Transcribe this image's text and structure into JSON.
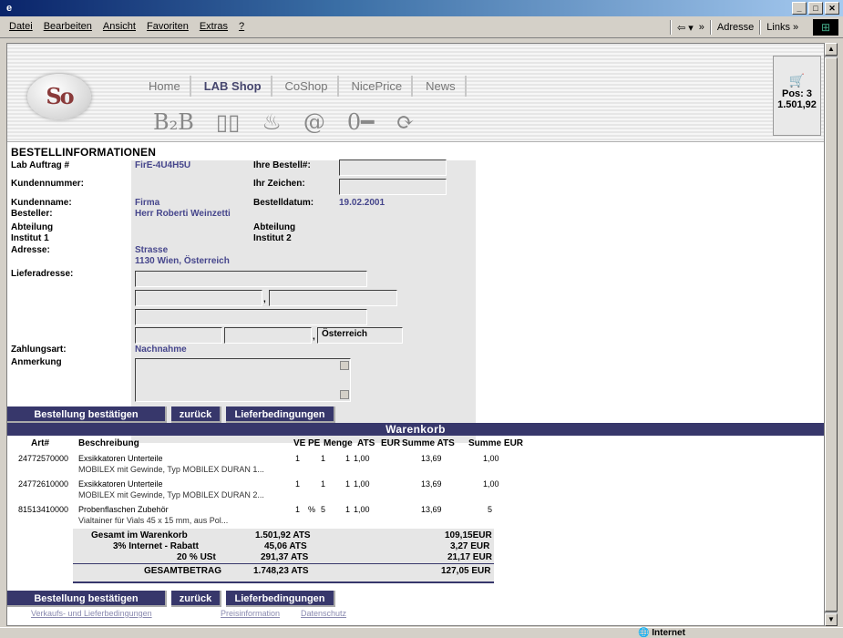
{
  "menu": [
    "Datei",
    "Bearbeiten",
    "Ansicht",
    "Favoriten",
    "Extras",
    "?"
  ],
  "toolbar": {
    "back": "⇦ ▾",
    "more": "»",
    "address": "Adresse",
    "links": "Links »"
  },
  "status": {
    "zone": "Internet"
  },
  "site": {
    "logo": "So",
    "tabs": [
      "Home",
      "LAB Shop",
      "CoShop",
      "NicePrice",
      "News"
    ],
    "active_tab": "LAB Shop",
    "icons": [
      "B2B",
      "book-icon",
      "stamp-icon",
      "at-icon",
      "key-icon",
      "refresh-icon"
    ],
    "icon_labels": [
      "B₂B",
      "▯▯",
      "♨",
      "@",
      "0━",
      "⟳"
    ],
    "cart": {
      "pos": "Pos: 3",
      "amount": "1.501,92"
    }
  },
  "order": {
    "title": "BESTELLINFORMATIONEN",
    "labels": {
      "lab_auftrag": "Lab Auftrag #",
      "kundennummer": "Kundennummer:",
      "kundenname": "Kundenname:",
      "besteller": "Besteller:",
      "abteilung": "Abteilung",
      "institut1": "Institut 1",
      "adresse": "Adresse:",
      "lieferadresse": "Lieferadresse:",
      "zahlungsart": "Zahlungsart:",
      "anmerkung": "Anmerkung",
      "ihre_bestell": "Ihre Bestell#:",
      "ihr_zeichen": "Ihr Zeichen:",
      "bestelldatum": "Bestelldatum:",
      "abteilung2": "Abteilung",
      "institut2": "Institut 2"
    },
    "values": {
      "lab_auftrag": "FirE-4U4H5U",
      "kundenname": "Firma",
      "besteller": "Herr Roberti Weinzetti",
      "bestelldatum": "19.02.2001",
      "strasse": "Strasse",
      "ort": "1130 Wien, Österreich",
      "zahlungsart": "Nachnahme",
      "land": "Österreich",
      "comma": ","
    },
    "buttons": {
      "confirm": "Bestellung bestätigen",
      "back": "zurück",
      "terms": "Lieferbedingungen"
    }
  },
  "cart": {
    "title": "Warenkorb",
    "headers": [
      "Art#",
      "Beschreibung",
      "VE",
      "PE",
      "Menge",
      "ATS",
      "EUR",
      "Summe ATS",
      "Summe EUR"
    ],
    "rows": [
      {
        "art": "24772570000",
        "desc": "Exsikkatoren Unterteile",
        "desc2": "MOBILEX mit Gewinde, Typ MOBILEX DURAN 1...",
        "ve": "1",
        "pe": "1",
        "menge": "1",
        "ats": "1,00",
        "sum_ats": "13,69",
        "sum_eur": "1,00"
      },
      {
        "art": "24772610000",
        "desc": "Exsikkatoren Unterteile",
        "desc2": "MOBILEX mit Gewinde, Typ MOBILEX DURAN 2...",
        "ve": "1",
        "pe": "1",
        "menge": "1",
        "ats": "1,00",
        "sum_ats": "13,69",
        "sum_eur": "1,00"
      },
      {
        "art": "81513410000",
        "desc": "Probenflaschen Zubehör",
        "desc2": "Vialtainer für Vials 45 x 15 mm, aus Pol...",
        "ve": "1",
        "pe": "%",
        "menge": "5",
        "ats": "1",
        "eur": "1,00",
        "sum_ats": "13,69",
        "sum_eur": "5"
      }
    ],
    "totals": [
      {
        "label": "Gesamt im Warenkorb",
        "ats": "1.501,92 ATS",
        "eur": "109,15EUR"
      },
      {
        "label": "3% Internet - Rabatt",
        "ats": "45,06 ATS",
        "eur": "3,27 EUR"
      },
      {
        "label": "20 % USt",
        "ats": "291,37 ATS",
        "eur": "21,17 EUR"
      },
      {
        "label": "GESAMTBETRAG",
        "ats": "1.748,23 ATS",
        "eur": "127,05 EUR"
      }
    ]
  },
  "footer": {
    "links": [
      "Verkaufs- und Lieferbedingungen",
      "Preisinformation",
      "Datenschutz"
    ]
  }
}
